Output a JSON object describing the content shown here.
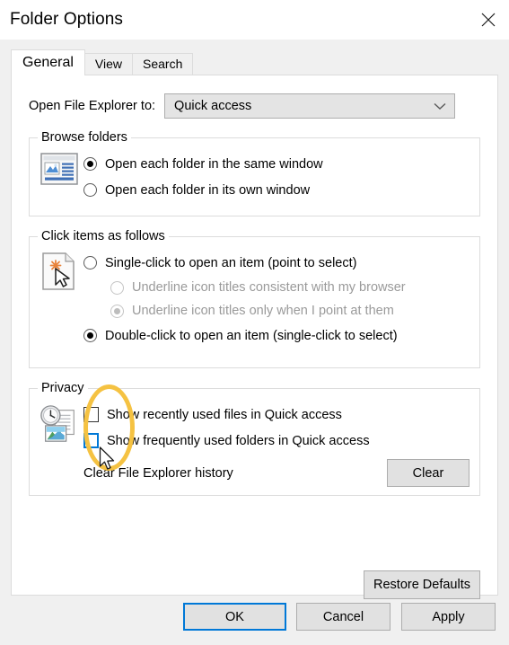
{
  "window": {
    "title": "Folder Options",
    "close_icon": "close-x-icon"
  },
  "tabs": [
    {
      "label": "General",
      "active": true
    },
    {
      "label": "View",
      "active": false
    },
    {
      "label": "Search",
      "active": false
    }
  ],
  "general": {
    "open_explorer": {
      "label": "Open File Explorer to:",
      "value": "Quick access",
      "arrow_icon": "chevron-down-icon"
    },
    "browse_folders": {
      "title": "Browse folders",
      "icon": "window-preview-icon",
      "options": [
        {
          "label": "Open each folder in the same window",
          "checked": true
        },
        {
          "label": "Open each folder in its own window",
          "checked": false
        }
      ]
    },
    "click_items": {
      "title": "Click items as follows",
      "icon": "document-click-icon",
      "options": [
        {
          "label": "Single-click to open an item (point to select)",
          "checked": false,
          "disabled": false,
          "sub": false
        },
        {
          "label": "Underline icon titles consistent with my browser",
          "checked": false,
          "disabled": true,
          "sub": true
        },
        {
          "label": "Underline icon titles only when I point at them",
          "checked": true,
          "disabled": true,
          "sub": true
        },
        {
          "label": "Double-click to open an item (single-click to select)",
          "checked": true,
          "disabled": false,
          "sub": false
        }
      ]
    },
    "privacy": {
      "title": "Privacy",
      "icon": "clock-documents-icon",
      "checkboxes": [
        {
          "label": "Show recently used files in Quick access",
          "checked": false,
          "focused": false
        },
        {
          "label": "Show frequently used folders in Quick access",
          "checked": false,
          "focused": true
        }
      ],
      "clear_history_label": "Clear File Explorer history",
      "clear_button": "Clear"
    },
    "restore_defaults_button": "Restore Defaults"
  },
  "footer": {
    "ok": "OK",
    "cancel": "Cancel",
    "apply": "Apply"
  },
  "annotation": {
    "highlight_color": "#f5c242",
    "shape": "ellipse",
    "cursor": "arrow-pointer"
  }
}
